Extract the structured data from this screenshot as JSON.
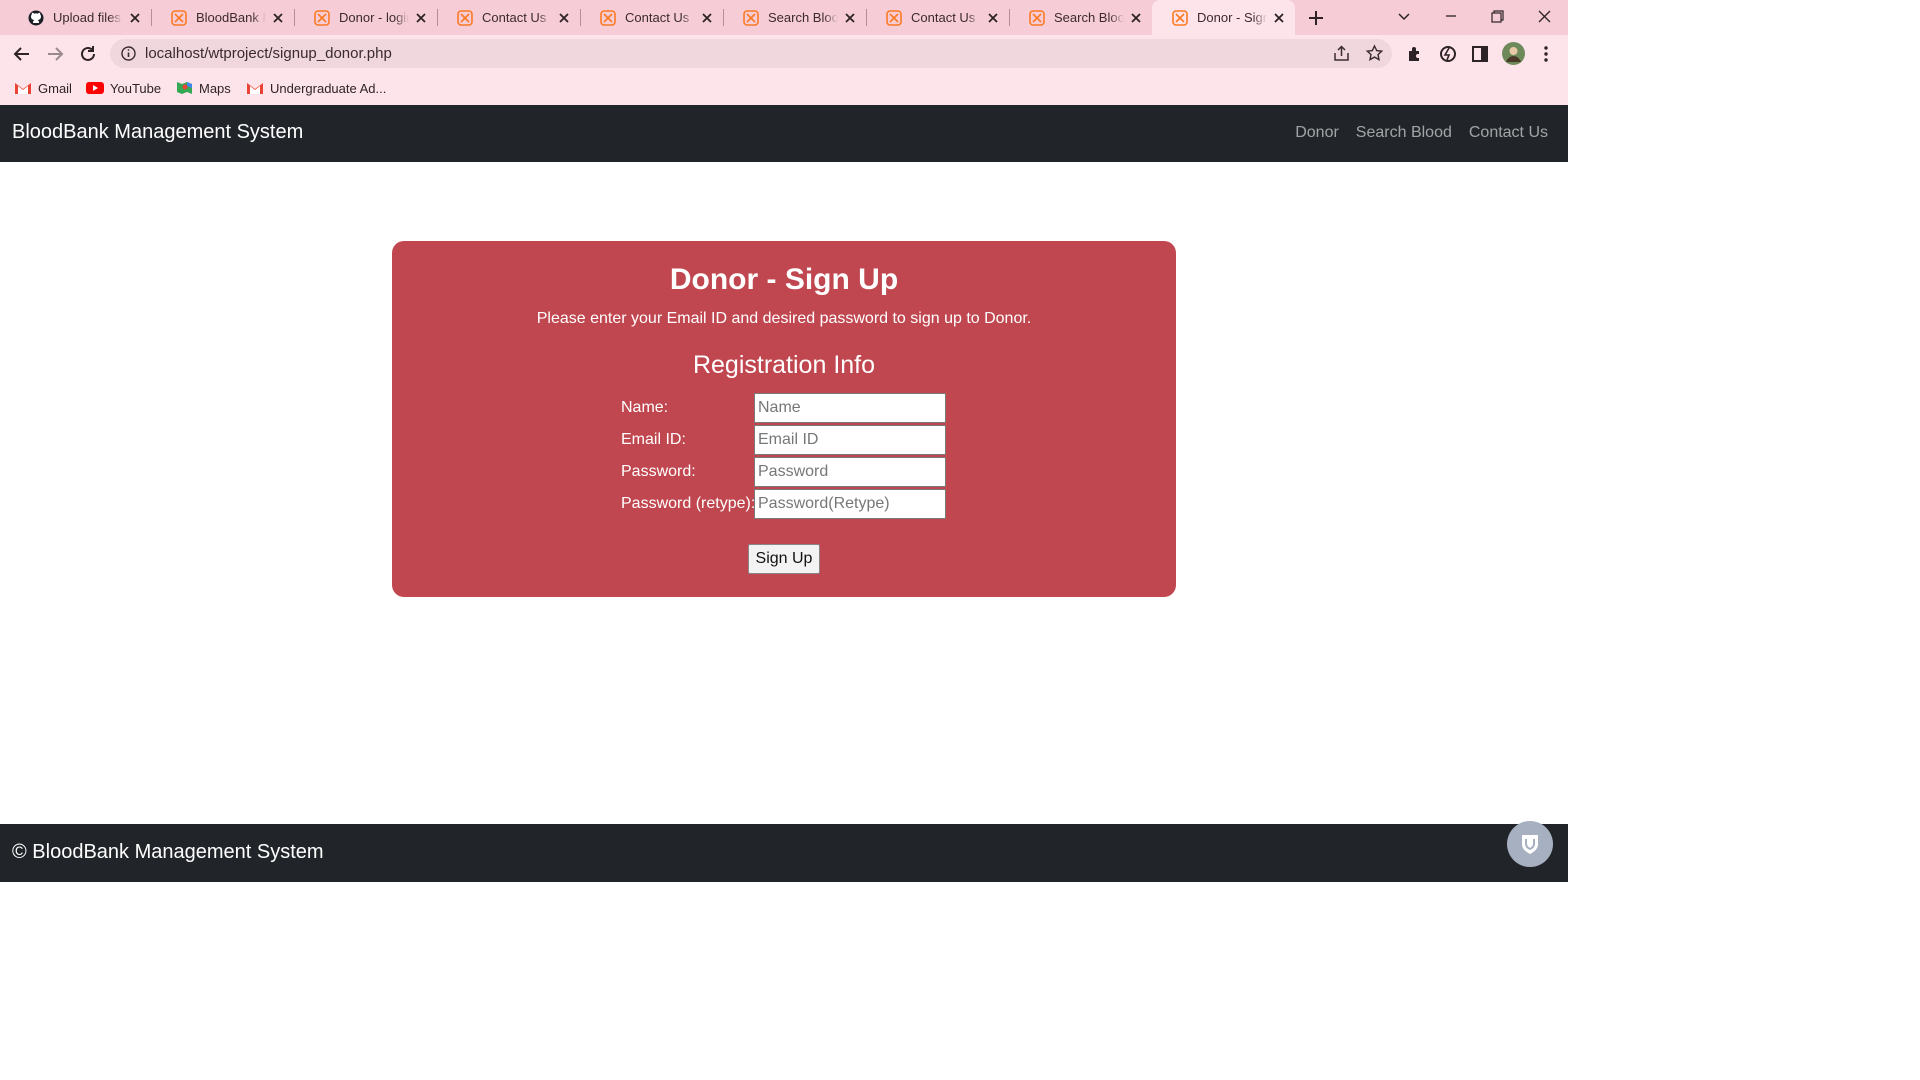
{
  "browser": {
    "tabs": [
      {
        "label": "Upload files · n",
        "favicon": "github-icon",
        "active": false
      },
      {
        "label": "BloodBank Ma",
        "favicon": "xampp-icon",
        "active": false
      },
      {
        "label": "Donor - login",
        "favicon": "xampp-icon",
        "active": false
      },
      {
        "label": "Contact Us",
        "favicon": "xampp-icon",
        "active": false
      },
      {
        "label": "Contact Us",
        "favicon": "xampp-icon",
        "active": false
      },
      {
        "label": "Search Blood",
        "favicon": "xampp-icon",
        "active": false
      },
      {
        "label": "Contact Us",
        "favicon": "xampp-icon",
        "active": false
      },
      {
        "label": "Search Blood",
        "favicon": "xampp-icon",
        "active": false
      },
      {
        "label": "Donor - Sign U",
        "favicon": "xampp-icon",
        "active": true
      }
    ],
    "url": "localhost/wtproject/signup_donor.php",
    "bookmarks": [
      {
        "label": "Gmail",
        "icon": "gmail-icon"
      },
      {
        "label": "YouTube",
        "icon": "youtube-icon"
      },
      {
        "label": "Maps",
        "icon": "maps-icon"
      },
      {
        "label": "Undergraduate Ad...",
        "icon": "gmail-icon"
      }
    ],
    "colors": {
      "tabstrip": "#f6cdd6",
      "toolbar": "#fde4ea"
    }
  },
  "site": {
    "brand": "BloodBank Management System",
    "nav": [
      "Donor",
      "Search Blood",
      "Contact Us"
    ]
  },
  "signup": {
    "title": "Donor - Sign Up",
    "subtitle": "Please enter your Email ID and desired password to sign up to Donor.",
    "section_title": "Registration Info",
    "fields": [
      {
        "label": "Name:",
        "placeholder": "Name",
        "value": ""
      },
      {
        "label": "Email ID:",
        "placeholder": "Email ID",
        "value": ""
      },
      {
        "label": "Password:",
        "placeholder": "Password",
        "value": ""
      },
      {
        "label": "Password (retype):",
        "placeholder": "Password(Retype)",
        "value": ""
      }
    ],
    "submit_label": "Sign Up",
    "colors": {
      "card": "#c0474f",
      "navbar": "#212529"
    }
  },
  "footer": {
    "text": "© BloodBank Management System"
  }
}
